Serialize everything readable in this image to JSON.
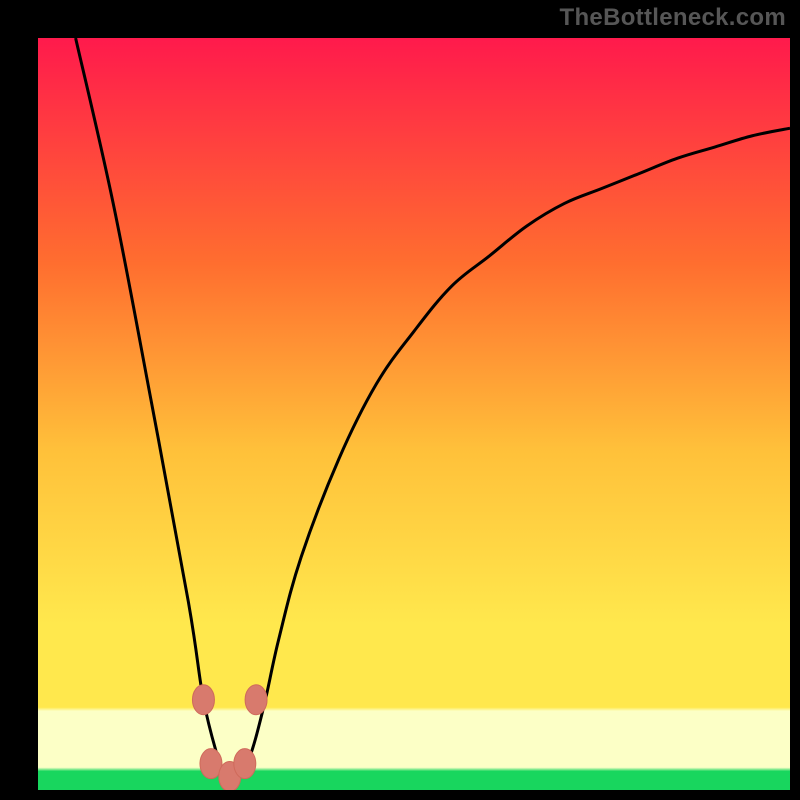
{
  "watermark": "TheBottleneck.com",
  "colors": {
    "bg_black": "#000000",
    "grad_top": "#ff1a4c",
    "grad_mid1": "#ff6e2f",
    "grad_mid2": "#ffc13a",
    "grad_mid3": "#ffe84d",
    "grad_paleband": "#fcffc6",
    "grad_green": "#18d65e",
    "curve_stroke": "#000000",
    "marker_fill": "#d87a6d",
    "marker_stroke": "#cf6a5b"
  },
  "chart_data": {
    "type": "line",
    "title": "",
    "xlabel": "",
    "ylabel": "",
    "xlim": [
      0,
      100
    ],
    "ylim": [
      0,
      100
    ],
    "series": [
      {
        "name": "bottleneck-curve",
        "x": [
          5,
          10,
          15,
          20,
          22,
          24,
          25,
          26,
          28,
          30,
          32,
          35,
          40,
          45,
          50,
          55,
          60,
          65,
          70,
          75,
          80,
          85,
          90,
          95,
          100
        ],
        "values": [
          100,
          78,
          52,
          25,
          12,
          4,
          1,
          1,
          4,
          11,
          20,
          31,
          44,
          54,
          61,
          67,
          71,
          75,
          78,
          80,
          82,
          84,
          85.5,
          87,
          88
        ]
      }
    ],
    "markers": [
      {
        "x": 22.0,
        "y": 12.0
      },
      {
        "x": 23.0,
        "y": 3.5
      },
      {
        "x": 25.5,
        "y": 1.8
      },
      {
        "x": 27.5,
        "y": 3.5
      },
      {
        "x": 29.0,
        "y": 12.0
      }
    ],
    "green_band_y": 3.0,
    "pale_band_y": 11.0
  }
}
